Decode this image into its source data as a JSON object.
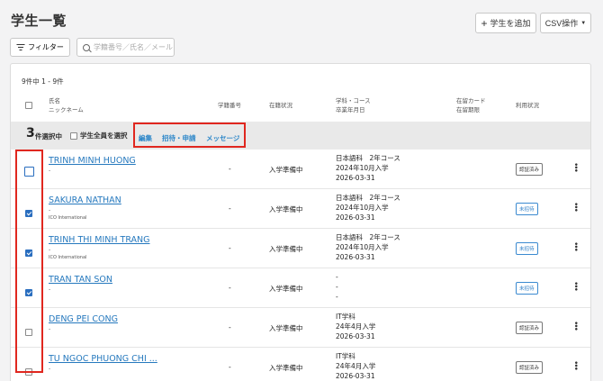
{
  "page": {
    "title": "学生一覧"
  },
  "toolbar": {
    "add_student": "学生を追加",
    "csv": "CSV操作",
    "filter": "フィルター",
    "search_placeholder": "学籍番号／氏名／メール"
  },
  "table": {
    "count": "9件中 1 - 9件",
    "headers": {
      "name": "氏名",
      "nickname": "ニックネーム",
      "student_no": "学籍番号",
      "status": "在籍状況",
      "course": "学科・コース",
      "grad": "卒業年月日",
      "card": "在留カード",
      "card_expiry": "在留期限",
      "usage": "利用状況"
    },
    "selection": {
      "num": "3",
      "text": "件選択中",
      "select_all": "学生全員を選択",
      "edit": "編集",
      "invite": "招待・申請",
      "message": "メッセージ"
    },
    "rows": [
      {
        "name": "TRINH MINH HUONG",
        "sub1": "-",
        "sub2": "",
        "no": "-",
        "status": "入学準備中",
        "course": [
          "日本語科　2年コース",
          "2024年10月入学",
          "2026-03-31"
        ],
        "badge": "認証済み",
        "badge_type": "grey",
        "checked": false,
        "focus": true
      },
      {
        "name": "SAKURA NATHAN",
        "sub1": "-",
        "sub2": "ICO International",
        "no": "-",
        "status": "入学準備中",
        "course": [
          "日本語科　2年コース",
          "2024年10月入学",
          "2026-03-31"
        ],
        "badge": "未招待",
        "badge_type": "blue",
        "checked": true,
        "focus": false
      },
      {
        "name": "TRINH THI MINH TRANG",
        "sub1": "-",
        "sub2": "ICO International",
        "no": "-",
        "status": "入学準備中",
        "course": [
          "日本語科　2年コース",
          "2024年10月入学",
          "2026-03-31"
        ],
        "badge": "未招待",
        "badge_type": "blue",
        "checked": true,
        "focus": false
      },
      {
        "name": "TRAN TAN SON",
        "sub1": "-",
        "sub2": "",
        "no": "-",
        "status": "入学準備中",
        "course": [
          "-",
          "-",
          "-"
        ],
        "badge": "未招待",
        "badge_type": "blue",
        "checked": true,
        "focus": false
      },
      {
        "name": "DENG PEI CONG",
        "sub1": "-",
        "sub2": "",
        "no": "-",
        "status": "入学準備中",
        "course": [
          "IT学科",
          "24年4月入学",
          "2026-03-31"
        ],
        "badge": "認証済み",
        "badge_type": "grey",
        "checked": false,
        "focus": false
      },
      {
        "name": "TU NGOC PHUONG CHI ...",
        "sub1": "-",
        "sub2": "",
        "no": "-",
        "status": "入学準備中",
        "course": [
          "IT学科",
          "24年4月入学",
          "2026-03-31"
        ],
        "badge": "認証済み",
        "badge_type": "grey",
        "checked": false,
        "focus": false
      }
    ]
  }
}
